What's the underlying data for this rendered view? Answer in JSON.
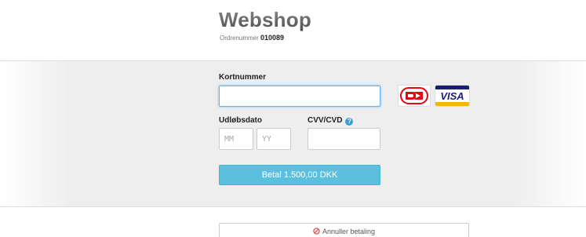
{
  "header": {
    "shop_name": "Webshop",
    "order_label": "Ordrenummer",
    "order_number": "010089"
  },
  "form": {
    "card_number_label": "Kortnummer",
    "card_number_value": "",
    "expiry_label": "Udløbsdato",
    "month_placeholder": "MM",
    "year_placeholder": "YY",
    "cvv_label": "CVV/CVD",
    "cvv_help_icon": "question-circle-icon",
    "cvv_help_glyph": "?",
    "card_logos": [
      {
        "name": "dankort-logo",
        "text": "DK",
        "color": "#e30613"
      },
      {
        "name": "visa-logo",
        "text": "VISA",
        "color": "#1a1f71"
      }
    ],
    "pay_label": "Betal 1.500,00 DKK",
    "cancel_label": "Annuller betaling",
    "cancel_icon": "ban-icon"
  },
  "colors": {
    "accent": "#5bc0de",
    "focus_border": "#66afe9",
    "help_icon": "#3d9bd6",
    "cancel_icon": "#d9534f"
  }
}
